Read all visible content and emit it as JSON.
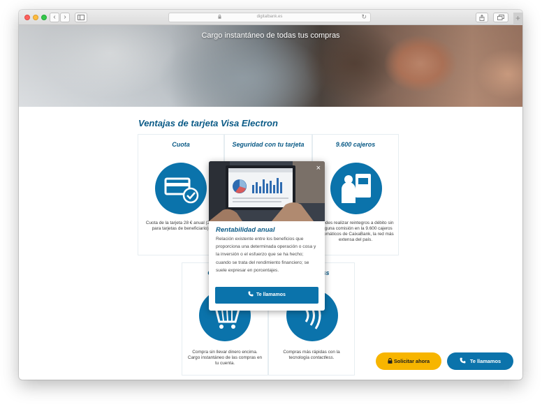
{
  "browser": {
    "url": "digitalbank.es",
    "back_glyph": "‹",
    "forward_glyph": "›",
    "plus_glyph": "+",
    "reload_glyph": "↻"
  },
  "hero": {
    "title": "Cargo instantáneo de todas tus compras"
  },
  "section": {
    "title": "Ventajas de tarjeta Visa Electron"
  },
  "cards": [
    {
      "title": "Cuota",
      "icon": "card-check-icon",
      "text": "Cuota de la tarjeta 28 € anual (23 € para tarjetas de beneficiario)."
    },
    {
      "title": "Seguridad con tu tarjeta",
      "icon": "shield-icon",
      "text": ""
    },
    {
      "title": "9.600 cajeros",
      "icon": "atm-icon",
      "text": "Puedes realizar reintegros a débito sin ninguna comisión en la 9.600 cajeros automáticos de CaixaBank, la red más extensa del país."
    },
    {
      "title": "Comodidad",
      "icon": "shopping-cart-icon",
      "text": "Compra sin llevar dinero encima. Cargo instantáneo de las compras en tu cuenta."
    },
    {
      "title": "Contactless",
      "icon": "contactless-icon",
      "text": "Compras más rápidas con la tecnología ",
      "text_em": "contactless."
    }
  ],
  "popup": {
    "close_glyph": "×",
    "title": "Rentabilidad anual",
    "text": "Relación existente entre los beneficios que proporciona una determinada operación o cosa y la inversión o el esfuerzo que se ha hecho; cuando se trata del rendimiento financiero; se suele expresar en porcentajes.",
    "button_label": "Te llamamos"
  },
  "cta": {
    "request_label": "Solicitar ahora",
    "call_label": "Te llamamos"
  },
  "colors": {
    "primary": "#0b73ab",
    "title": "#0a5a86",
    "accent": "#f7b500"
  }
}
